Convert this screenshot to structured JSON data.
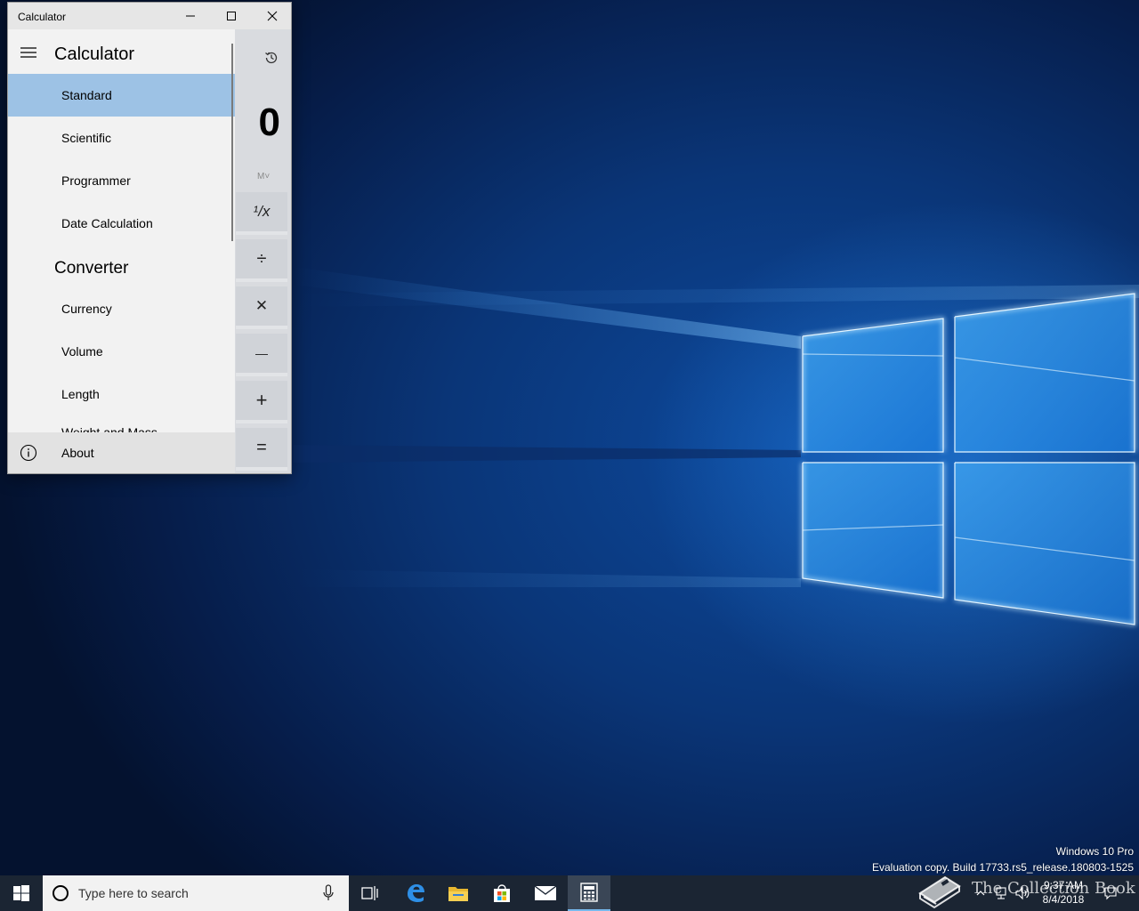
{
  "window": {
    "title": "Calculator",
    "minimize_glyph": "—",
    "close_glyph": "✕"
  },
  "calculator": {
    "display": "0",
    "memory_label": "M˅",
    "operators": [
      "¹/x",
      "÷",
      "✕",
      "—",
      "+",
      "="
    ]
  },
  "nav": {
    "title": "Calculator",
    "calculator_items": [
      "Standard",
      "Scientific",
      "Programmer",
      "Date Calculation"
    ],
    "selected": "Standard",
    "converter_heading": "Converter",
    "converter_items": [
      "Currency",
      "Volume",
      "Length"
    ],
    "partial_item": "Weight and Mass",
    "about_label": "About"
  },
  "watermark": {
    "edition": "Windows 10 Pro",
    "build": "Evaluation copy. Build 17733.rs5_release.180803-1525"
  },
  "taskbar": {
    "search_placeholder": "Type here to search",
    "apps": [
      "task-view",
      "edge",
      "file-explorer",
      "store",
      "mail",
      "calculator"
    ],
    "active_app": "calculator",
    "clock_time": "9:37 AM",
    "clock_date": "8/4/2018"
  },
  "overlay": {
    "text": "The Collection Book"
  },
  "colors": {
    "selected_nav": "#9dc2e5",
    "taskbar": "#1b2533",
    "accent": "#76b9ed"
  }
}
